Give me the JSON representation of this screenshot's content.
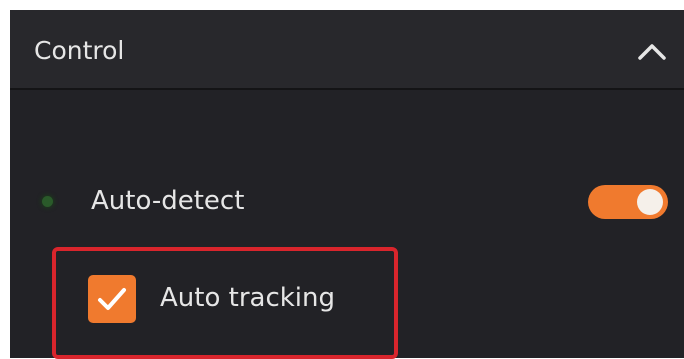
{
  "control_panel": {
    "title": "Control",
    "collapse_icon": "chevron-up-icon",
    "auto_detect": {
      "label": "Auto-detect",
      "status_icon": "status-dot-icon",
      "enabled": true
    },
    "auto_tracking": {
      "label": "Auto tracking",
      "checked": true,
      "check_icon": "checkmark-icon"
    }
  },
  "colors": {
    "panel_background": "#222226",
    "header_background": "#28282c",
    "accent": "#f07a2e",
    "highlight_border": "#d9252c",
    "text": "#e6e6e6"
  }
}
